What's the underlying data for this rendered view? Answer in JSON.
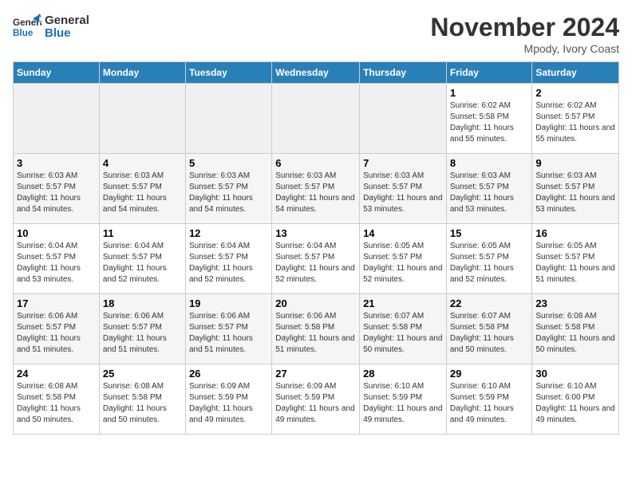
{
  "header": {
    "logo_line1": "General",
    "logo_line2": "Blue",
    "month_title": "November 2024",
    "location": "Mpody, Ivory Coast"
  },
  "days_of_week": [
    "Sunday",
    "Monday",
    "Tuesday",
    "Wednesday",
    "Thursday",
    "Friday",
    "Saturday"
  ],
  "weeks": [
    [
      {
        "num": "",
        "info": ""
      },
      {
        "num": "",
        "info": ""
      },
      {
        "num": "",
        "info": ""
      },
      {
        "num": "",
        "info": ""
      },
      {
        "num": "",
        "info": ""
      },
      {
        "num": "1",
        "info": "Sunrise: 6:02 AM\nSunset: 5:58 PM\nDaylight: 11 hours and 55 minutes."
      },
      {
        "num": "2",
        "info": "Sunrise: 6:02 AM\nSunset: 5:57 PM\nDaylight: 11 hours and 55 minutes."
      }
    ],
    [
      {
        "num": "3",
        "info": "Sunrise: 6:03 AM\nSunset: 5:57 PM\nDaylight: 11 hours and 54 minutes."
      },
      {
        "num": "4",
        "info": "Sunrise: 6:03 AM\nSunset: 5:57 PM\nDaylight: 11 hours and 54 minutes."
      },
      {
        "num": "5",
        "info": "Sunrise: 6:03 AM\nSunset: 5:57 PM\nDaylight: 11 hours and 54 minutes."
      },
      {
        "num": "6",
        "info": "Sunrise: 6:03 AM\nSunset: 5:57 PM\nDaylight: 11 hours and 54 minutes."
      },
      {
        "num": "7",
        "info": "Sunrise: 6:03 AM\nSunset: 5:57 PM\nDaylight: 11 hours and 53 minutes."
      },
      {
        "num": "8",
        "info": "Sunrise: 6:03 AM\nSunset: 5:57 PM\nDaylight: 11 hours and 53 minutes."
      },
      {
        "num": "9",
        "info": "Sunrise: 6:03 AM\nSunset: 5:57 PM\nDaylight: 11 hours and 53 minutes."
      }
    ],
    [
      {
        "num": "10",
        "info": "Sunrise: 6:04 AM\nSunset: 5:57 PM\nDaylight: 11 hours and 53 minutes."
      },
      {
        "num": "11",
        "info": "Sunrise: 6:04 AM\nSunset: 5:57 PM\nDaylight: 11 hours and 52 minutes."
      },
      {
        "num": "12",
        "info": "Sunrise: 6:04 AM\nSunset: 5:57 PM\nDaylight: 11 hours and 52 minutes."
      },
      {
        "num": "13",
        "info": "Sunrise: 6:04 AM\nSunset: 5:57 PM\nDaylight: 11 hours and 52 minutes."
      },
      {
        "num": "14",
        "info": "Sunrise: 6:05 AM\nSunset: 5:57 PM\nDaylight: 11 hours and 52 minutes."
      },
      {
        "num": "15",
        "info": "Sunrise: 6:05 AM\nSunset: 5:57 PM\nDaylight: 11 hours and 52 minutes."
      },
      {
        "num": "16",
        "info": "Sunrise: 6:05 AM\nSunset: 5:57 PM\nDaylight: 11 hours and 51 minutes."
      }
    ],
    [
      {
        "num": "17",
        "info": "Sunrise: 6:06 AM\nSunset: 5:57 PM\nDaylight: 11 hours and 51 minutes."
      },
      {
        "num": "18",
        "info": "Sunrise: 6:06 AM\nSunset: 5:57 PM\nDaylight: 11 hours and 51 minutes."
      },
      {
        "num": "19",
        "info": "Sunrise: 6:06 AM\nSunset: 5:57 PM\nDaylight: 11 hours and 51 minutes."
      },
      {
        "num": "20",
        "info": "Sunrise: 6:06 AM\nSunset: 5:58 PM\nDaylight: 11 hours and 51 minutes."
      },
      {
        "num": "21",
        "info": "Sunrise: 6:07 AM\nSunset: 5:58 PM\nDaylight: 11 hours and 50 minutes."
      },
      {
        "num": "22",
        "info": "Sunrise: 6:07 AM\nSunset: 5:58 PM\nDaylight: 11 hours and 50 minutes."
      },
      {
        "num": "23",
        "info": "Sunrise: 6:08 AM\nSunset: 5:58 PM\nDaylight: 11 hours and 50 minutes."
      }
    ],
    [
      {
        "num": "24",
        "info": "Sunrise: 6:08 AM\nSunset: 5:58 PM\nDaylight: 11 hours and 50 minutes."
      },
      {
        "num": "25",
        "info": "Sunrise: 6:08 AM\nSunset: 5:58 PM\nDaylight: 11 hours and 50 minutes."
      },
      {
        "num": "26",
        "info": "Sunrise: 6:09 AM\nSunset: 5:59 PM\nDaylight: 11 hours and 49 minutes."
      },
      {
        "num": "27",
        "info": "Sunrise: 6:09 AM\nSunset: 5:59 PM\nDaylight: 11 hours and 49 minutes."
      },
      {
        "num": "28",
        "info": "Sunrise: 6:10 AM\nSunset: 5:59 PM\nDaylight: 11 hours and 49 minutes."
      },
      {
        "num": "29",
        "info": "Sunrise: 6:10 AM\nSunset: 5:59 PM\nDaylight: 11 hours and 49 minutes."
      },
      {
        "num": "30",
        "info": "Sunrise: 6:10 AM\nSunset: 6:00 PM\nDaylight: 11 hours and 49 minutes."
      }
    ]
  ]
}
